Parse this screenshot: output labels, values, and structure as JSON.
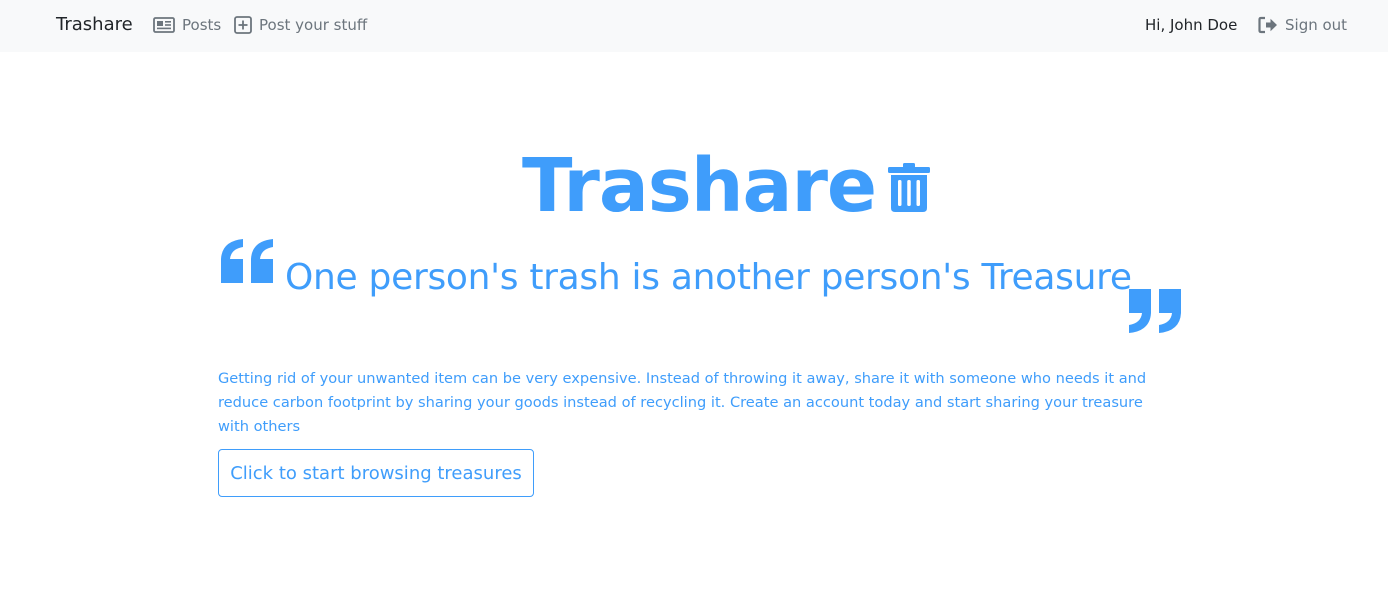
{
  "navbar": {
    "brand": "Trashare",
    "links": [
      {
        "label": "Posts",
        "icon": "newspaper-icon"
      },
      {
        "label": "Post your stuff",
        "icon": "plus-square-icon"
      }
    ],
    "greeting": "Hi, John Doe",
    "signout": {
      "label": "Sign out",
      "icon": "sign-out-icon"
    }
  },
  "hero": {
    "title": "Trashare",
    "title_icon": "trash-icon",
    "tagline": "One person's trash is another person's Treasure",
    "description": "Getting rid of your unwanted item can be very expensive. Instead of throwing it away, share it with someone who needs it and reduce carbon footprint by sharing your goods instead of recycling it. Create an account today and start sharing your treasure with others",
    "cta_label": "Click to start browsing treasures"
  },
  "colors": {
    "accent": "#3f9dfb",
    "navbar_bg": "#f8f9fa",
    "nav_link": "#6c757d",
    "text_dark": "#212529"
  }
}
